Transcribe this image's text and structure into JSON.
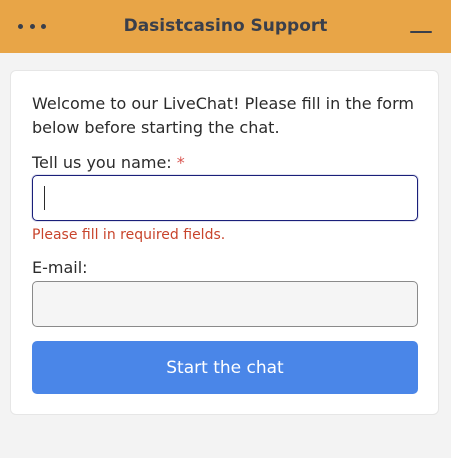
{
  "header": {
    "title": "Dasistcasino Support",
    "menu_icon": "more-horizontal-icon",
    "minimize_icon": "minimize-icon",
    "background_color": "#e8a547"
  },
  "form": {
    "welcome_text": "Welcome to our LiveChat! Please fill in the form below before starting the chat.",
    "name_label": "Tell us you name:",
    "required_marker": "*",
    "name_value": "",
    "error_text": "Please fill in required fields.",
    "email_label": "E-mail:",
    "email_value": "",
    "submit_label": "Start the chat",
    "submit_color": "#4a86e8",
    "error_color": "#c8442c"
  }
}
